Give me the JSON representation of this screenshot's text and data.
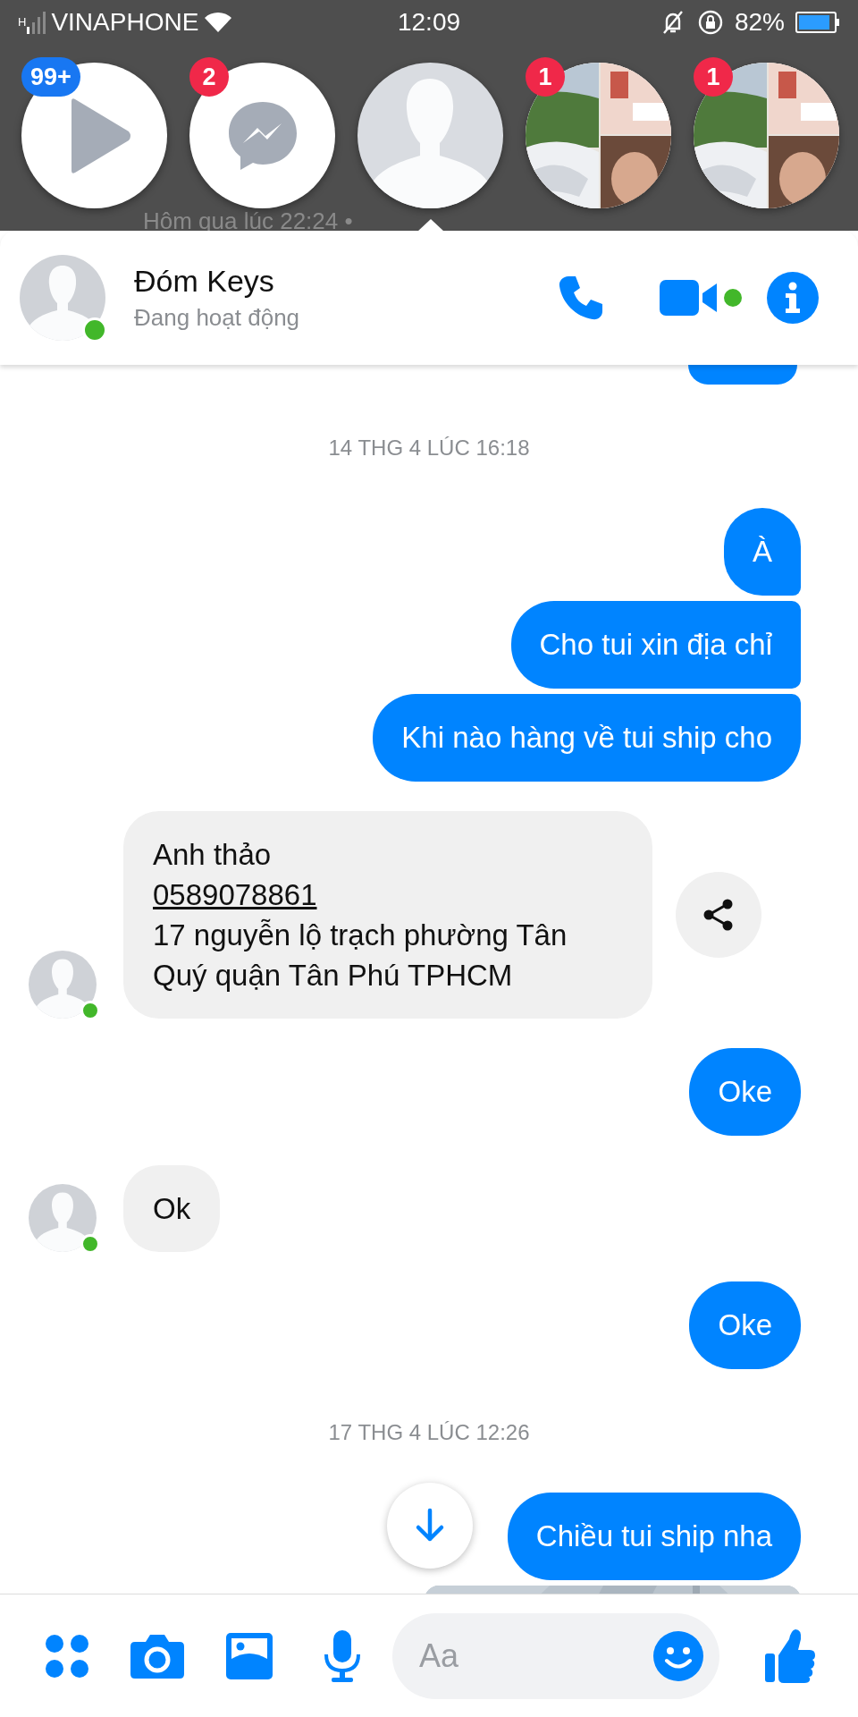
{
  "status_bar": {
    "network": "H",
    "carrier": "VINAPHONE",
    "time": "12:09",
    "battery": "82%"
  },
  "background_post": {
    "time": "Hôm qua lúc 22:24 •"
  },
  "chat_heads": [
    {
      "kind": "play",
      "badge": "99+",
      "color": "#1877f2",
      "selected": false
    },
    {
      "kind": "messenger",
      "badge": "2",
      "color": "#f02849",
      "selected": false
    },
    {
      "kind": "avatar",
      "selected": true
    },
    {
      "kind": "picture",
      "badge": "1",
      "color": "#f02849",
      "selected": false
    },
    {
      "kind": "picture",
      "badge": "1",
      "color": "#f02849",
      "selected": false
    }
  ],
  "conversation": {
    "name": "Đóm Keys",
    "status": "Đang hoạt động",
    "online": true
  },
  "messages": [
    {
      "kind": "timestamp",
      "text": "14 THG 4 LÚC 16:18"
    },
    {
      "kind": "sent",
      "text": "À"
    },
    {
      "kind": "sent",
      "text": "Cho tui xin địa chỉ"
    },
    {
      "kind": "sent",
      "text": "Khi nào hàng về tui ship cho"
    },
    {
      "kind": "received",
      "share": true,
      "lines": [
        {
          "kind": "text",
          "text": "Anh thảo"
        },
        {
          "kind": "link",
          "text": "0589078861"
        },
        {
          "kind": "text",
          "text": "17 nguyễn lộ trạch phường Tân Quý quận Tân Phú TPHCM"
        }
      ]
    },
    {
      "kind": "sent",
      "text": "Oke"
    },
    {
      "kind": "received",
      "share": false,
      "lines": [
        {
          "kind": "text",
          "text": "Ok"
        }
      ]
    },
    {
      "kind": "sent",
      "text": "Oke"
    },
    {
      "kind": "timestamp",
      "text": "17 THG 4 LÚC 12:26"
    },
    {
      "kind": "sent",
      "text": "Chiều tui ship nha"
    },
    {
      "kind": "picture"
    }
  ],
  "scroll_down_button": true,
  "composer": {
    "placeholder": "Aa"
  }
}
